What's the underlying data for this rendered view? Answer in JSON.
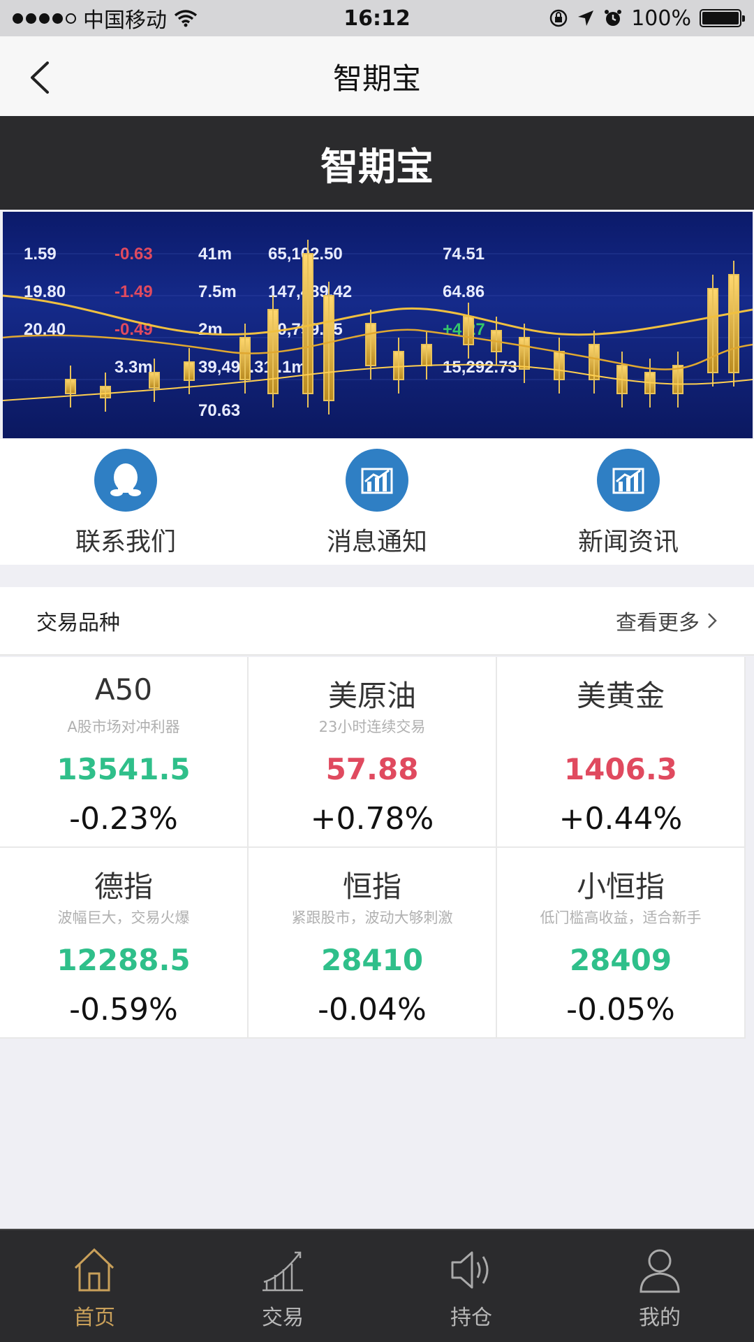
{
  "status_bar": {
    "carrier": "中国移动",
    "time": "16:12",
    "battery": "100%"
  },
  "nav": {
    "title": "智期宝"
  },
  "header": {
    "brand": "智期宝"
  },
  "shortcuts": [
    {
      "label": "联系我们",
      "icon": "qq-penguin-icon"
    },
    {
      "label": "消息通知",
      "icon": "chart-icon"
    },
    {
      "label": "新闻资讯",
      "icon": "chart-icon"
    }
  ],
  "section": {
    "title": "交易品种",
    "more": "查看更多"
  },
  "products": [
    {
      "name": "A50",
      "desc": "A股市场对冲利器",
      "price": "13541.5",
      "change": "-0.23%",
      "trend": "down"
    },
    {
      "name": "美原油",
      "desc": "23小时连续交易",
      "price": "57.88",
      "change": "+0.78%",
      "trend": "up"
    },
    {
      "name": "美黄金",
      "desc": "",
      "price": "1406.3",
      "change": "+0.44%",
      "trend": "up"
    },
    {
      "name": "德指",
      "desc": "波幅巨大，交易火爆",
      "price": "12288.5",
      "change": "-0.59%",
      "trend": "down"
    },
    {
      "name": "恒指",
      "desc": "紧跟股市，波动大够刺激",
      "price": "28410",
      "change": "-0.04%",
      "trend": "down"
    },
    {
      "name": "小恒指",
      "desc": "低门槛高收益，适合新手",
      "price": "28409",
      "change": "-0.05%",
      "trend": "down"
    }
  ],
  "tabs": [
    {
      "label": "首页",
      "icon": "home-icon",
      "active": true
    },
    {
      "label": "交易",
      "icon": "trend-icon",
      "active": false
    },
    {
      "label": "持仓",
      "icon": "speaker-icon",
      "active": false
    },
    {
      "label": "我的",
      "icon": "user-icon",
      "active": false
    }
  ],
  "banner": {
    "numbers": [
      "1.59",
      "-0.63",
      "41m",
      "65,102.50",
      "74.51",
      "19.80",
      "-1.49",
      "7.5m",
      "147,489.42",
      "64.86",
      "20.40",
      "-0.49",
      "2m",
      "40,799.15",
      "+4.27",
      "3.3m",
      "39,498.31",
      "7.1m",
      "15,292.73",
      "70.63"
    ]
  },
  "colors": {
    "up": "#e04a5f",
    "down": "#2fbf8a",
    "accent": "#2f7fc4",
    "tab_active": "#c9a05a"
  }
}
